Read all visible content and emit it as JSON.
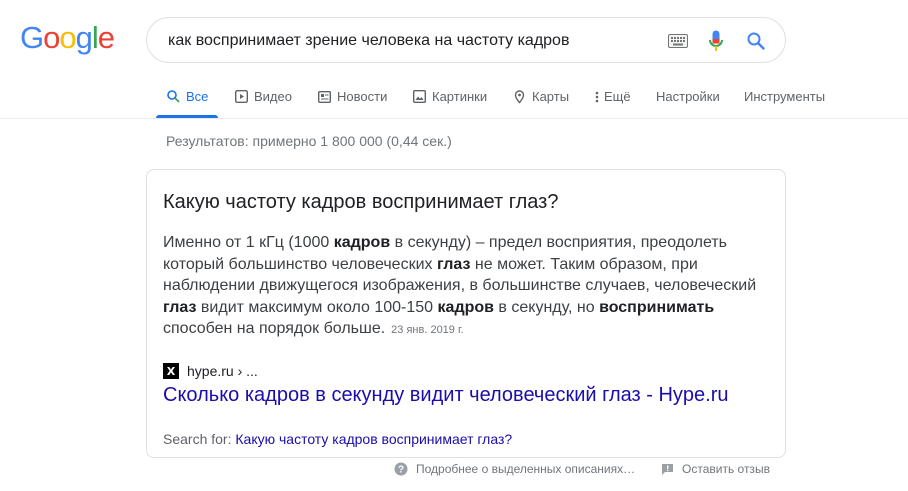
{
  "logo": {
    "letters": [
      "G",
      "o",
      "o",
      "g",
      "l",
      "e"
    ],
    "colors": [
      "#4285f4",
      "#ea4335",
      "#fbbc05",
      "#4285f4",
      "#34a853",
      "#ea4335"
    ]
  },
  "search": {
    "query": "как воспринимает зрение человека на частоту кадров",
    "icons": [
      "keyboard-icon",
      "mic-icon",
      "search-icon"
    ]
  },
  "tabs": [
    {
      "label": "Все",
      "icon": "search-icon",
      "active": true
    },
    {
      "label": "Видео",
      "icon": "play-icon"
    },
    {
      "label": "Новости",
      "icon": "news-icon"
    },
    {
      "label": "Картинки",
      "icon": "image-icon"
    },
    {
      "label": "Карты",
      "icon": "map-icon"
    },
    {
      "label": "Ещё",
      "icon": "more-vert-icon"
    },
    {
      "label": "Настройки"
    },
    {
      "label": "Инструменты"
    }
  ],
  "results_stats": "Результатов: примерно 1 800 000 (0,44 сек.)",
  "snippet": {
    "title": "Какую частоту кадров воспринимает глаз?",
    "body": [
      {
        "t": "Именно от 1 кГц (1000 ",
        "b": false
      },
      {
        "t": "кадров",
        "b": true
      },
      {
        "t": " в секунду) – предел восприятия, преодолеть который большинство человеческих ",
        "b": false
      },
      {
        "t": "глаз",
        "b": true
      },
      {
        "t": " не может. Таким образом, при наблюдении движущегося изображения, в большинстве случаев, человеческий ",
        "b": false
      },
      {
        "t": "глаз",
        "b": true
      },
      {
        "t": " видит максимум около 100-150 ",
        "b": false
      },
      {
        "t": "кадров",
        "b": true
      },
      {
        "t": " в секунду, но ",
        "b": false
      },
      {
        "t": "воспринимать",
        "b": true
      },
      {
        "t": " способен на порядок больше.",
        "b": false
      }
    ],
    "date": "23 янв. 2019 г.",
    "favicon_letter": "X",
    "site": "hype.ru › ...",
    "link_title": "Сколько кадров в секунду видит человеческий глаз - Hype.ru",
    "search_for_label": "Search for:",
    "search_for_query": "Какую частоту кадров воспринимает глаз?"
  },
  "footer": {
    "about_label": "Подробнее о выделенных описаниях…",
    "feedback_label": "Оставить отзыв"
  },
  "colors": {
    "accent": "#1a73e8",
    "link": "#1a0dab",
    "muted": "#70757a"
  }
}
